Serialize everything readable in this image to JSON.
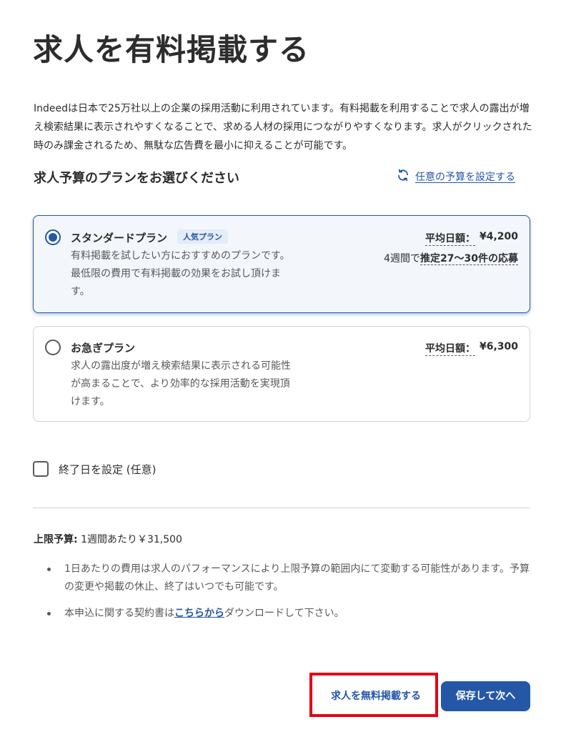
{
  "page": {
    "title": "求人を有料掲載する",
    "intro": "Indeedは日本で25万社以上の企業の採用活動に利用されています。有料掲載を利用することで求人の露出が増え検索結果に表示されやすくなることで、求める人材の採用につながりやすくなります。求人がクリックされた時のみ課金されるため、無駄な広告費を最小に抑えることが可能です。"
  },
  "plans_section": {
    "heading": "求人予算のプランをお選びください",
    "custom_budget_label": "任意の予算を設定する",
    "custom_budget_icon": "refresh-icon"
  },
  "plans": [
    {
      "name": "スタンダードプラン",
      "badge": "人気プラン",
      "description": "有料掲載を試したい方におすすめのプランです。最低限の費用で有料掲載の効果をお試し頂けます。",
      "avg_label": "平均日額：",
      "avg_value": "¥4,200",
      "reach_prefix": "4週間で",
      "reach_value": "推定27〜30件の応募",
      "selected": true
    },
    {
      "name": "お急ぎプラン",
      "description": "求人の露出度が増え検索結果に表示される可能性が高まることで、より効率的な採用活動を実現頂けます。",
      "avg_label": "平均日額：",
      "avg_value": "¥6,300",
      "selected": false
    }
  ],
  "end_date": {
    "label": "終了日を設定 (任意)",
    "checked": false
  },
  "budget": {
    "label": "上限予算:",
    "value": "1週間あたり￥31,500"
  },
  "notes": {
    "note1": "1日あたりの費用は求人のパフォーマンスにより上限予算の範囲内にて変動する可能性があります。予算の変更や掲載の休止、終了はいつでも可能です。",
    "note2_prefix": "本申込に関する契約書は",
    "note2_link": "こちらから",
    "note2_suffix": "ダウンロードして下さい。"
  },
  "actions": {
    "free_post": "求人を無料掲載する",
    "save_next": "保存して次へ"
  },
  "colors": {
    "accent": "#2557a7",
    "highlight_border": "#e60012"
  }
}
